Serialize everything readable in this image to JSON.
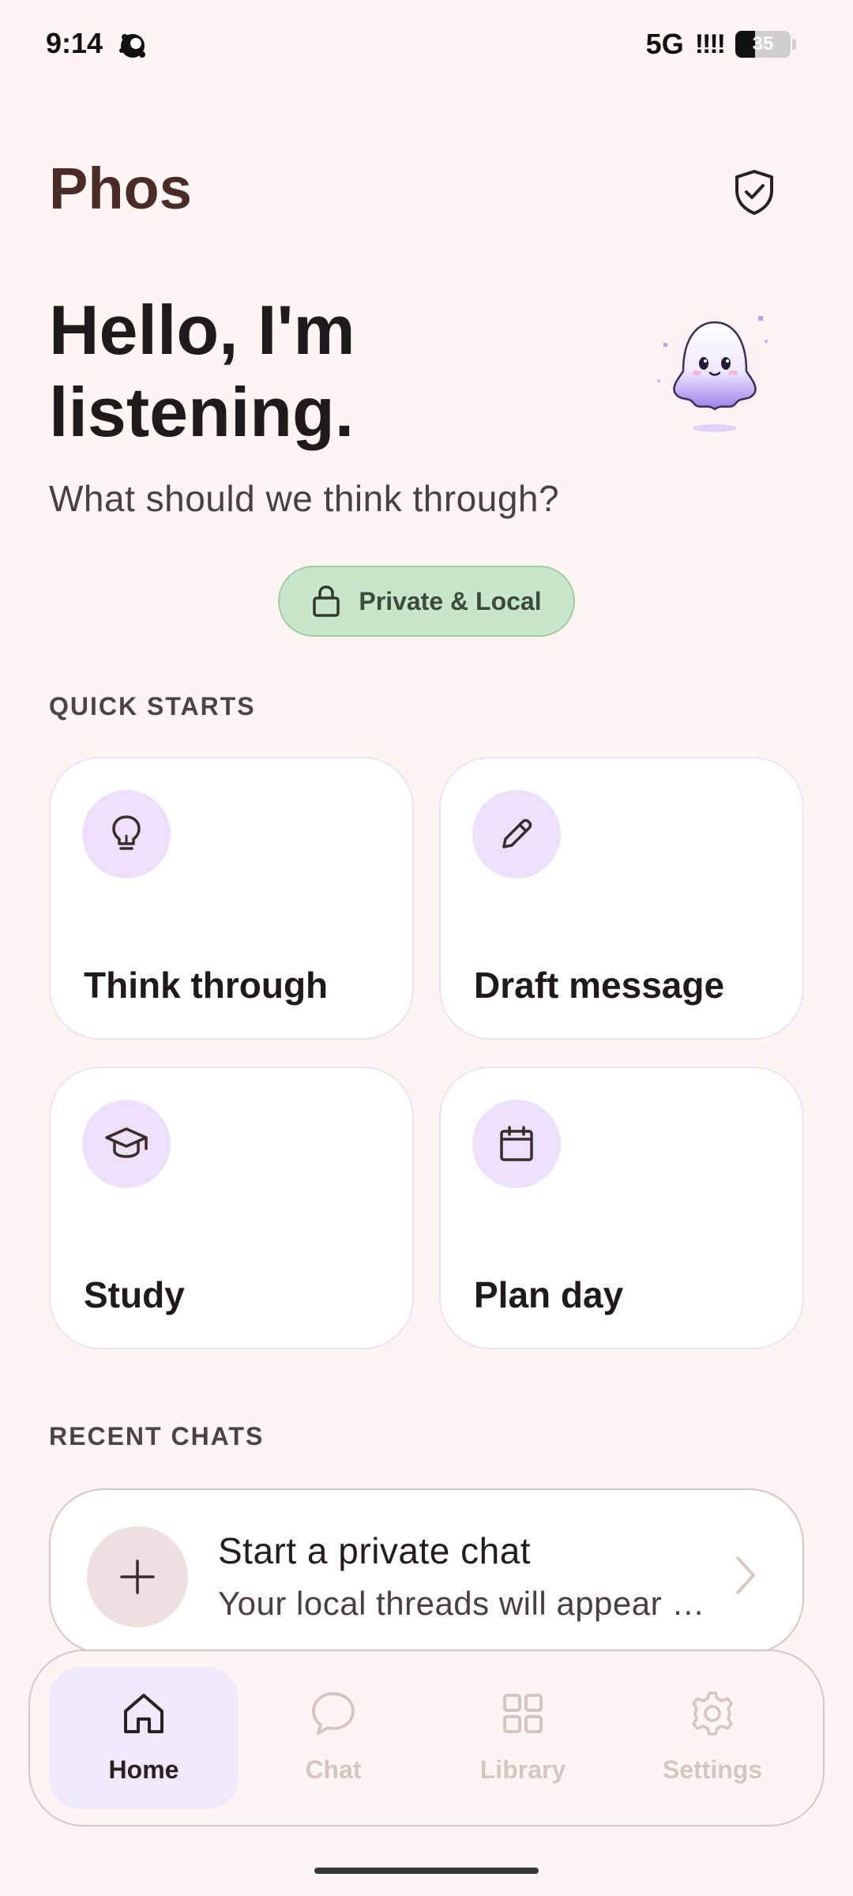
{
  "status_bar": {
    "time": "9:14",
    "network": "5G",
    "signal": "!!!!",
    "battery_level": "35",
    "battery_fraction": 0.35
  },
  "header": {
    "app_title": "Phos",
    "shield_icon": "shield-check-icon"
  },
  "hero": {
    "title": "Hello, I'm listening.",
    "subtitle": "What should we think through?",
    "mascot": "ghost-mascot"
  },
  "privacy_chip": {
    "label": "Private & Local",
    "icon": "lock-icon",
    "color": "#c8e6c9"
  },
  "quick_starts": {
    "section_label": "QUICK STARTS",
    "items": [
      {
        "label": "Think through",
        "icon": "lightbulb-icon"
      },
      {
        "label": "Draft message",
        "icon": "pencil-icon"
      },
      {
        "label": "Study",
        "icon": "graduation-cap-icon"
      },
      {
        "label": "Plan day",
        "icon": "calendar-icon"
      }
    ]
  },
  "recent_chats": {
    "section_label": "RECENT CHATS",
    "new_chat": {
      "title": "Start a private chat",
      "subtitle": "Your local threads will appear here",
      "icon": "plus-icon"
    }
  },
  "nav": {
    "items": [
      {
        "label": "Home",
        "icon": "home-icon",
        "active": true
      },
      {
        "label": "Chat",
        "icon": "chat-bubble-icon",
        "active": false
      },
      {
        "label": "Library",
        "icon": "grid-icon",
        "active": false
      },
      {
        "label": "Settings",
        "icon": "gear-icon",
        "active": false
      }
    ]
  },
  "colors": {
    "background": "#fff5f3",
    "accent_lavender": "#ede0fa",
    "title_brown": "#4a2b28"
  }
}
